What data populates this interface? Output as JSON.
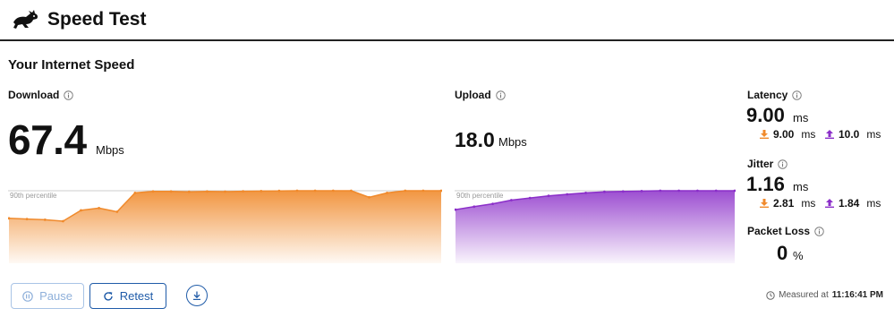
{
  "app": {
    "title": "Speed Test",
    "logo_icon": "rabbit-logo-icon"
  },
  "section_title": "Your Internet Speed",
  "download": {
    "label": "Download",
    "value": "67.4",
    "unit": "Mbps",
    "percentile_label": "90th percentile",
    "color": "#f08a2c",
    "samples": [
      0.62,
      0.61,
      0.6,
      0.58,
      0.73,
      0.76,
      0.71,
      0.97,
      0.99,
      0.99,
      0.985,
      0.99,
      0.988,
      0.992,
      0.995,
      0.998,
      1.0,
      1.0,
      1.0,
      1.0,
      0.91,
      0.97,
      1.0,
      1.0,
      1.0
    ]
  },
  "upload": {
    "label": "Upload",
    "value": "18.0",
    "unit": "Mbps",
    "percentile_label": "90th percentile",
    "color": "#8b2fc9",
    "samples": [
      0.74,
      0.78,
      0.82,
      0.87,
      0.9,
      0.93,
      0.95,
      0.97,
      0.985,
      0.99,
      0.995,
      1.0,
      1.0,
      1.0,
      1.0,
      1.0
    ]
  },
  "latency": {
    "label": "Latency",
    "value": "9.00",
    "unit": "ms",
    "down_value": "9.00",
    "up_value": "10.0",
    "sub_unit": "ms"
  },
  "jitter": {
    "label": "Jitter",
    "value": "1.16",
    "unit": "ms",
    "down_value": "2.81",
    "up_value": "1.84",
    "sub_unit": "ms"
  },
  "packet_loss": {
    "label": "Packet Loss",
    "value": "0",
    "unit": "%"
  },
  "controls": {
    "pause_label": "Pause",
    "retest_label": "Retest"
  },
  "measured": {
    "prefix": "Measured at",
    "time": "11:16:41 PM"
  },
  "colors": {
    "accent_blue": "#1f5ba8",
    "download": "#f08a2c",
    "upload": "#8b2fc9"
  }
}
